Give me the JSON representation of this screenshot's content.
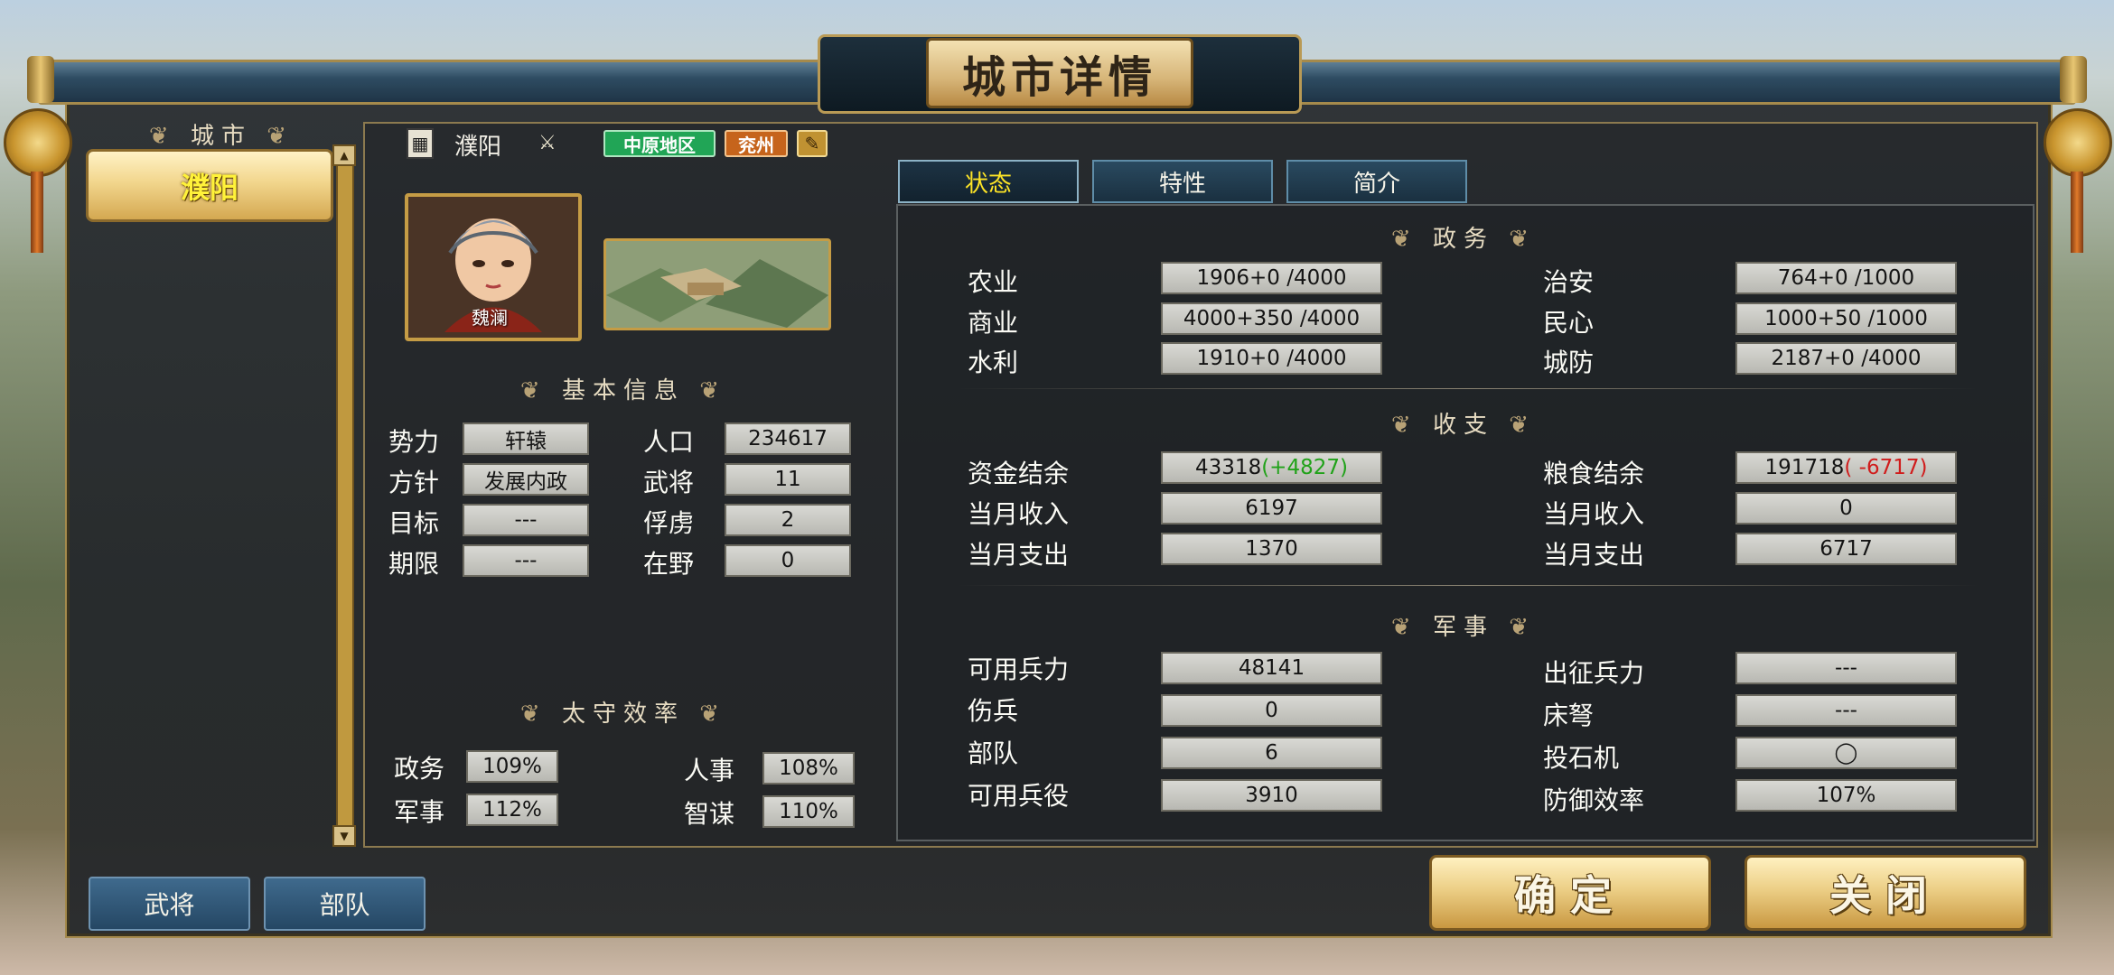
{
  "title": "城市详情",
  "city_list": {
    "header": "城市",
    "cities": [
      "濮阳"
    ]
  },
  "city_info": {
    "name": "濮阳",
    "region_tag": "中原地区",
    "province_tag": "兖州",
    "governor_name": "魏澜",
    "basic_header": "基本信息",
    "basic": [
      {
        "label": "势力",
        "value": "轩辕"
      },
      {
        "label": "人口",
        "value": "234617"
      },
      {
        "label": "方针",
        "value": "发展内政"
      },
      {
        "label": "武将",
        "value": "11"
      },
      {
        "label": "目标",
        "value": "---"
      },
      {
        "label": "俘虏",
        "value": "2"
      },
      {
        "label": "期限",
        "value": "---"
      },
      {
        "label": "在野",
        "value": "0"
      }
    ],
    "eff_header": "太守效率",
    "efficiency": [
      {
        "label": "政务",
        "value": "109%"
      },
      {
        "label": "人事",
        "value": "108%"
      },
      {
        "label": "军事",
        "value": "112%"
      },
      {
        "label": "智谋",
        "value": "110%"
      }
    ]
  },
  "tabs": [
    "状态",
    "特性",
    "简介"
  ],
  "politics": {
    "header": "政务",
    "rows": [
      {
        "label": "农业",
        "value": "1906+0 /4000"
      },
      {
        "label": "治安",
        "value": "764+0 /1000"
      },
      {
        "label": "商业",
        "value": "4000+350 /4000"
      },
      {
        "label": "民心",
        "value": "1000+50 /1000"
      },
      {
        "label": "水利",
        "value": "1910+0 /4000"
      },
      {
        "label": "城防",
        "value": "2187+0 /4000"
      }
    ]
  },
  "finance": {
    "header": "收支",
    "funds_label": "资金结余",
    "funds_value": "43318",
    "funds_delta": "(+4827)",
    "food_label": "粮食结余",
    "food_value": "191718",
    "food_delta": "( -6717)",
    "rows": [
      {
        "label": "当月收入",
        "value": "6197"
      },
      {
        "label": "当月收入",
        "value": "0"
      },
      {
        "label": "当月支出",
        "value": "1370"
      },
      {
        "label": "当月支出",
        "value": "6717"
      }
    ]
  },
  "military": {
    "header": "军事",
    "rows": [
      {
        "label": "可用兵力",
        "value": "48141"
      },
      {
        "label": "出征兵力",
        "value": "---"
      },
      {
        "label": "伤兵",
        "value": "0"
      },
      {
        "label": "床弩",
        "value": "---"
      },
      {
        "label": "部队",
        "value": "6"
      },
      {
        "label": "投石机",
        "value": "◯"
      },
      {
        "label": "可用兵役",
        "value": "3910"
      },
      {
        "label": "防御效率",
        "value": "107%"
      }
    ]
  },
  "bottom": {
    "generals": "武将",
    "troops": "部队",
    "confirm": "确定",
    "close": "关闭"
  },
  "colors": {
    "accent_gold": "#c59c45",
    "region_tag": "#1f9a4a",
    "province_tag": "#c96a1c",
    "positive": "#21a21a",
    "negative": "#d01c1c"
  }
}
